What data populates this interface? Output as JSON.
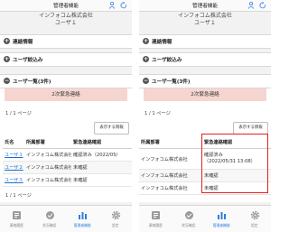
{
  "header": {
    "title": "管理者機能"
  },
  "account": {
    "company": "インフォコム株式会社",
    "user": "ユーザ１"
  },
  "sections": {
    "contact_info": "連絡情報",
    "user_filter": "ユーザ絞込み",
    "user_list": "ユーザ一覧(3件)"
  },
  "banner": "2次緊急連絡",
  "page_info": "1 / 1 ページ",
  "display_button": "表示する情報",
  "table": {
    "headers": {
      "name": "氏名",
      "dept": "所属部署",
      "status": "緊急連絡確認"
    },
    "rows": [
      {
        "name": "ユーザ１",
        "dept": "インフォコム株式会社",
        "status": "確認済み",
        "status_left": "確認済み（2022/05/",
        "date": "（2022/05/31 13:08）"
      },
      {
        "name": "ユーザ２",
        "dept": "インフォコム株式会社",
        "status": "未確認",
        "status_left": "未確認"
      },
      {
        "name": "ユーザ３",
        "dept": "インフォコム株式会社",
        "status": "未確認",
        "status_left": "未確認"
      }
    ]
  },
  "pager_bottom": "1 / 1 ページ",
  "tabs": [
    {
      "label": "連絡履歴"
    },
    {
      "label": "状況確認"
    },
    {
      "label": "管理者機能"
    },
    {
      "label": "設定"
    }
  ],
  "colors": {
    "accent": "#2f7de1",
    "alert_red": "#e0392f",
    "banner_bg": "#f6d5d0",
    "highlight_box": "#e12121"
  }
}
